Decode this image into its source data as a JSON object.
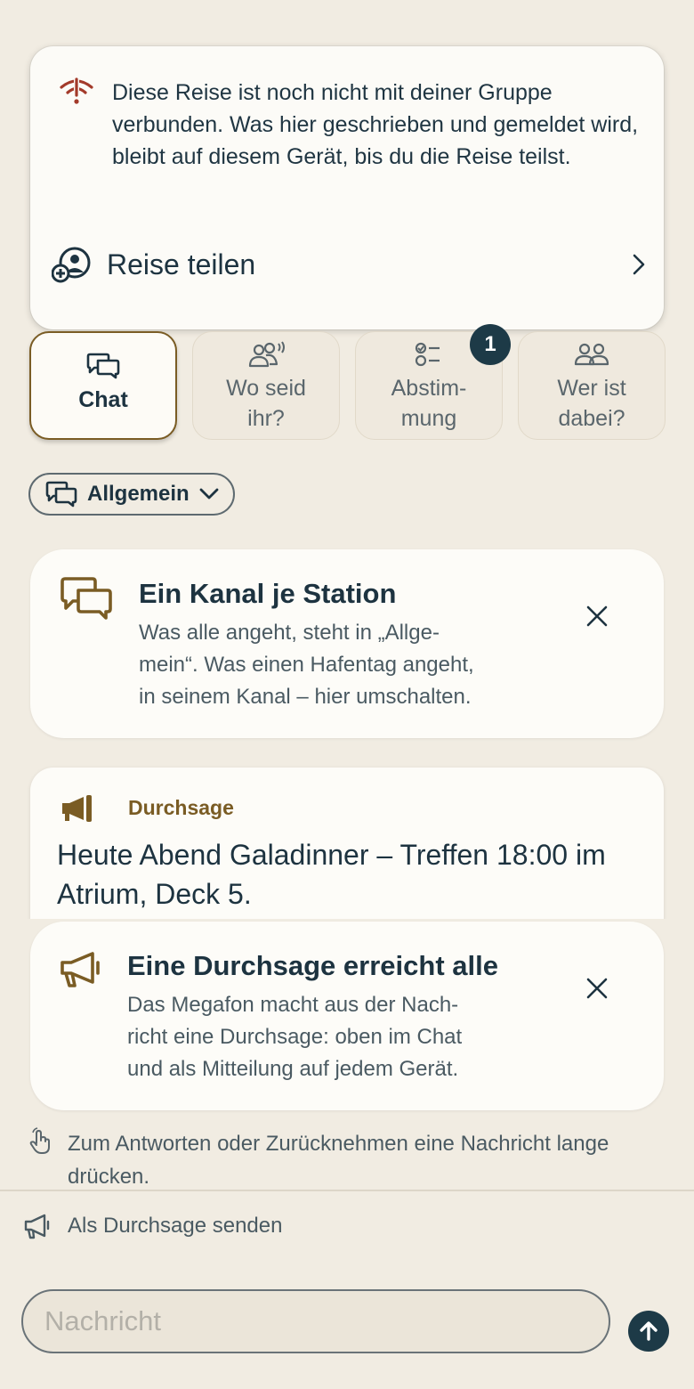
{
  "banner": {
    "icon": "wifi-off-icon",
    "text": "Diese Reise ist noch nicht mit deiner Gruppe verbunden. Was hier geschrieben und gemeldet wird, bleibt auf diesem Gerät, bis du die Reise teilst.",
    "share_label": "Reise teilen"
  },
  "tabs": [
    {
      "label": "Chat",
      "icon": "chat-bubbles-icon",
      "active": true
    },
    {
      "label": "Wo seid\nihr?",
      "icon": "group-location-icon"
    },
    {
      "label": "Abstim-\nmung",
      "icon": "checklist-icon",
      "badge": "1"
    },
    {
      "label": "Wer ist\ndabei?",
      "icon": "people-icon"
    }
  ],
  "channel": {
    "label": "Allgemein"
  },
  "hint_channel": {
    "title": "Ein Kanal je Station",
    "body": "Was alle angeht, steht in „Allge-\nmein“. Was einen Hafentag angeht,\nin seinem Kanal – hier umschalten."
  },
  "announcement": {
    "label": "Durchsage",
    "text": "Heute Abend Galadinner – Treffen 18:00 im Atrium, Deck 5."
  },
  "hint_announce": {
    "title": "Eine Durchsage erreicht alle",
    "body": "Das Megafon macht aus der Nach-\nricht eine Durchsage: oben im Chat\nund als Mitteilung auf jedem Gerät."
  },
  "long_press_hint": "Zum Antworten oder Zurücknehmen eine Nachricht lange drücken.",
  "send_as_announcement": "Als Durchsage senden",
  "composer": {
    "placeholder": "Nachricht"
  },
  "colors": {
    "accent_brown": "#7a5c24",
    "navy": "#1d3a47",
    "alert_red": "#a33a2a",
    "background": "#f1ece2"
  }
}
